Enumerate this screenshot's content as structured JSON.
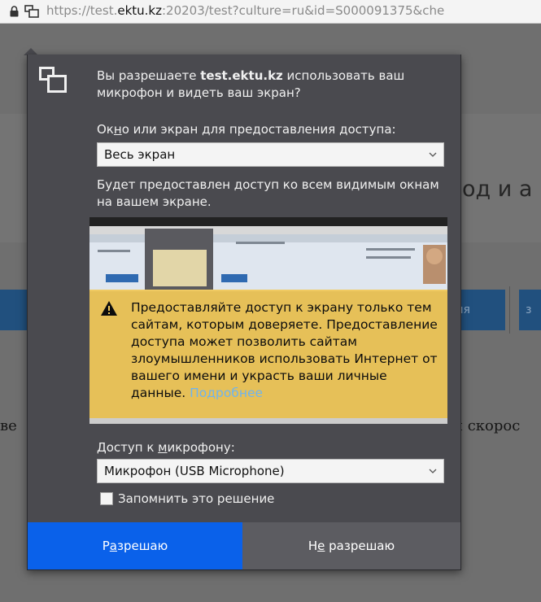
{
  "urlbar": {
    "url_prefix": "https://test.",
    "url_host": "ektu.kz",
    "url_rest": ":20203/test?culture=ru&id=S000091375&che"
  },
  "background": {
    "heading_fragment": "од и а",
    "button1_fragment": "мя",
    "button2_fragment": "з",
    "text_left_fragment": "ве",
    "text_right_fragment": "и скорос"
  },
  "dialog": {
    "question_prefix": "Вы разрешаете ",
    "question_host": "test.ektu.kz",
    "question_suffix": " использовать ваш микрофон и видеть ваш экран?",
    "screen_label_pre": "Ок",
    "screen_label_u": "н",
    "screen_label_post": "о или экран для предоставления доступа:",
    "screen_select_value": "Весь экран",
    "screen_note": "Будет предоставлен доступ ко всем видимым окнам на вашем экране.",
    "warning_lines": [
      "Предоставляйте доступ к экрану только тем",
      "сайтам, которым доверяете. Предоставление",
      "доступа может позволить сайтам",
      "злоумышленников использовать Интернет от",
      "вашего имени и украсть ваши личные"
    ],
    "warning_last": "данные. ",
    "warning_link": "Подробнее",
    "mic_label_pre": "Доступ к ",
    "mic_label_u": "м",
    "mic_label_post": "икрофону:",
    "mic_select_value": "Микрофон (USB Microphone)",
    "remember_label": "Запомнить это решение",
    "allow_pre": "Р",
    "allow_u": "а",
    "allow_post": "зрешаю",
    "deny_pre": "Н",
    "deny_u": "е",
    "deny_post": " разрешаю"
  },
  "colors": {
    "allow_button": "#0a61ea",
    "panel_bg": "#4a4a4f",
    "warning_bg": "#f0c85a",
    "link": "#6fb4ee"
  },
  "icons": [
    "lock-icon",
    "screen-share-icon",
    "chevron-down-icon",
    "warning-icon",
    "checkbox"
  ]
}
